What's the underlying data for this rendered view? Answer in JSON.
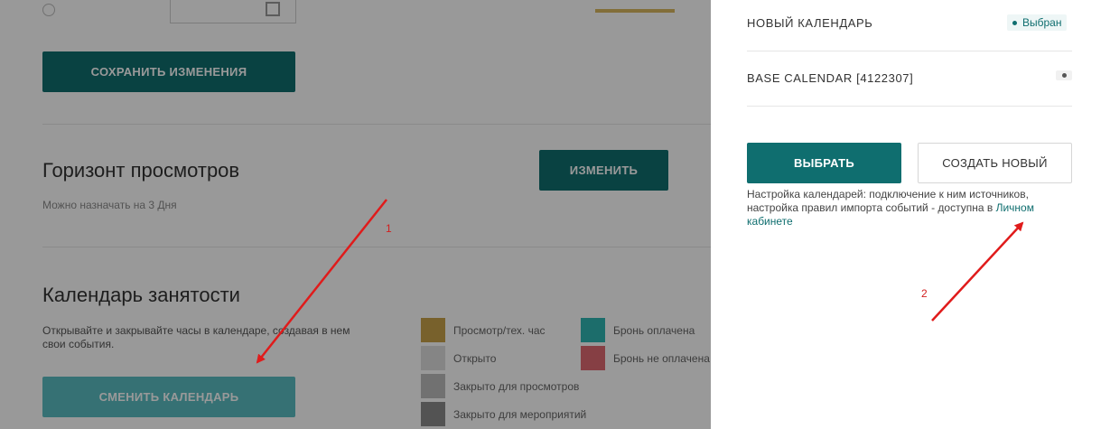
{
  "settings": {
    "save_button": "СОХРАНИТЬ ИЗМЕНЕНИЯ",
    "horizon": {
      "title": "Горизонт просмотров",
      "description": "Можно назначать на 3 Дня",
      "change_button": "ИЗМЕНИТЬ"
    },
    "calendar": {
      "title": "Календарь занятости",
      "description_line1": "Открывайте и закрывайте часы в календаре, создавая в нем",
      "description_line2": "свои события.",
      "change_button": "СМЕНИТЬ КАЛЕНДАРЬ"
    },
    "legend": [
      {
        "label": "Просмотр/тех. час",
        "color": "#c9a24a"
      },
      {
        "label": "Бронь оплачена",
        "color": "#2fb6b3"
      },
      {
        "label": "Открыто",
        "color": "#dedede"
      },
      {
        "label": "Бронь не оплачена",
        "color": "#e06a72"
      },
      {
        "label": "Закрыто для просмотров",
        "color": "#bdbdbd"
      },
      {
        "label": "Закрыто для мероприятий",
        "color": "#8a8a8a"
      }
    ]
  },
  "panel": {
    "calendars": [
      {
        "name": "НОВЫЙ КАЛЕНДАРЬ",
        "badge": "Выбран"
      },
      {
        "name": "BASE CALENDAR [4122307]",
        "badge": ""
      }
    ],
    "select_button": "ВЫБРАТЬ",
    "create_button": "СОЗДАТЬ НОВЫЙ",
    "info_text": "Настройка календарей: подключение к ним источников, настройка правил импорта событий - доступна в",
    "info_link": "Личном кабинете"
  },
  "annotations": {
    "marker1": "1",
    "marker2": "2",
    "arrow_color": "#e01b1b"
  }
}
